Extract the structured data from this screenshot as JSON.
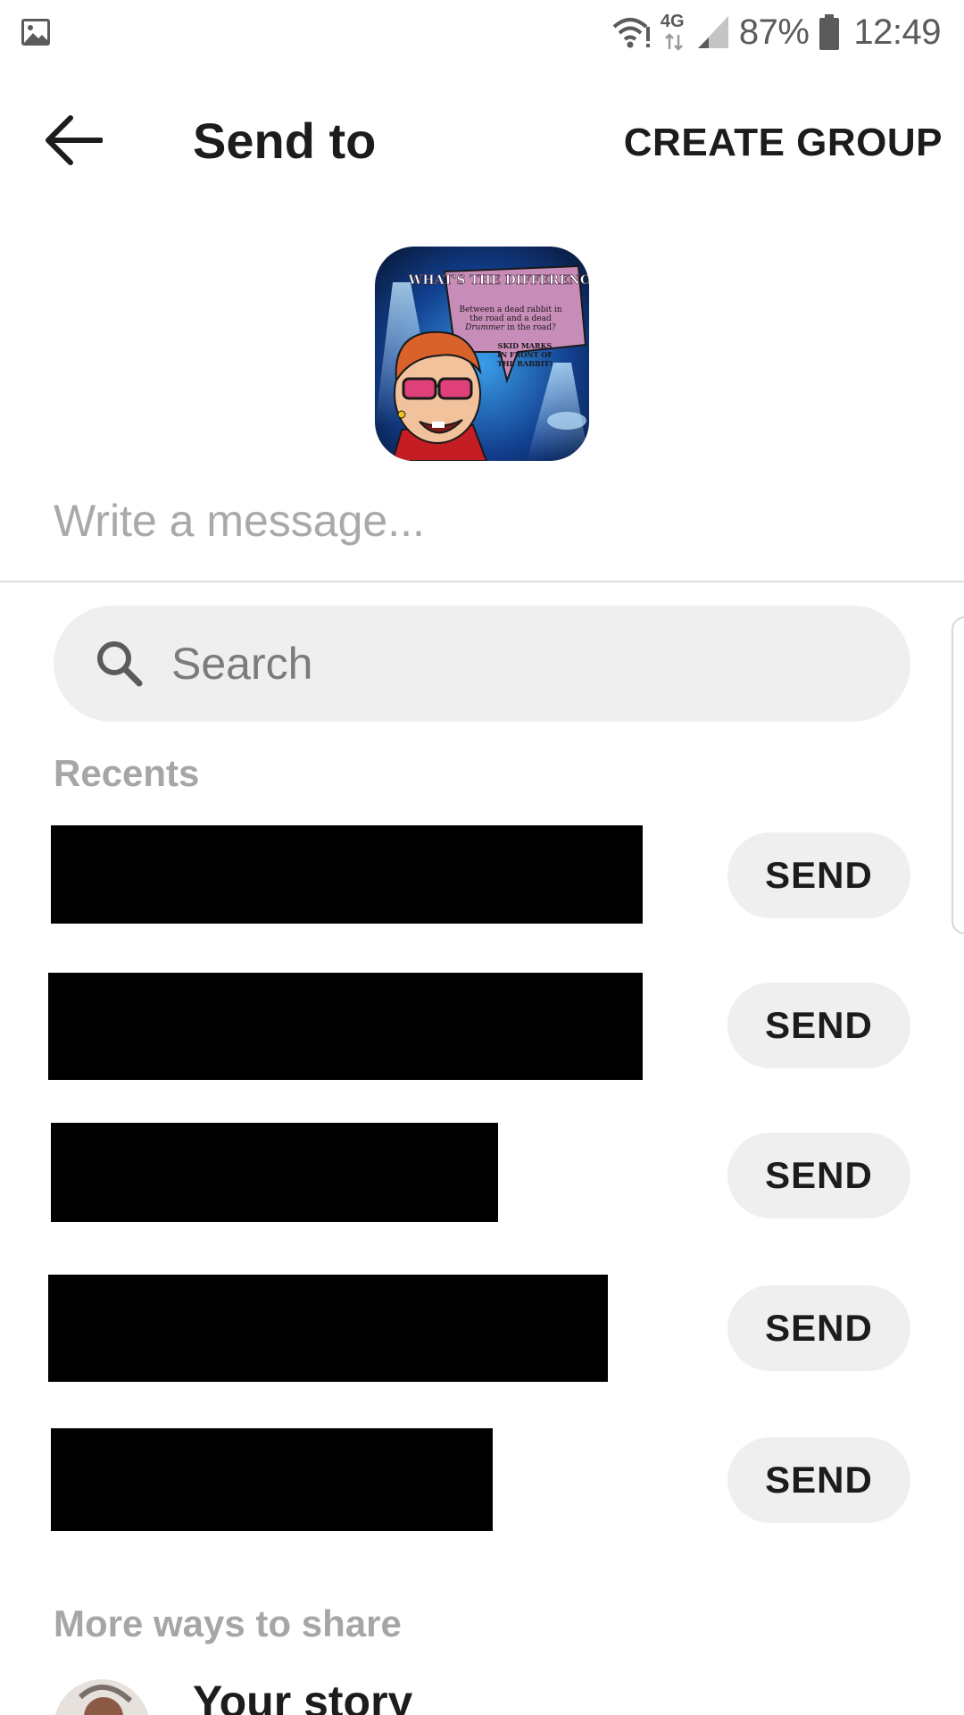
{
  "status_bar": {
    "network": "4G",
    "battery": "87%",
    "time": "12:49",
    "icons": [
      "gallery-icon",
      "wifi-alert-icon",
      "data-arrows-icon",
      "cell-signal-icon",
      "battery-icon"
    ]
  },
  "header": {
    "title": "Send to",
    "action": "CREATE GROUP",
    "back_icon": "arrow-left-icon"
  },
  "preview": {
    "headline": "WHAT'S THE DIFFERENCE...",
    "question_line1": "Between a dead rabbit in",
    "question_line2": "the road and a dead",
    "question_line3_em": "Drummer",
    "question_line3_rest": " in the road?",
    "answer_line1": "SKID MARKS",
    "answer_line2": "IN FRONT OF",
    "answer_line3": "THE RABBIT!"
  },
  "message": {
    "placeholder": "Write a message..."
  },
  "search": {
    "placeholder": "Search",
    "icon": "search-icon"
  },
  "recents": {
    "label": "Recents",
    "items": [
      {
        "send_label": "SEND"
      },
      {
        "send_label": "SEND"
      },
      {
        "send_label": "SEND"
      },
      {
        "send_label": "SEND"
      },
      {
        "send_label": "SEND"
      }
    ]
  },
  "more": {
    "label": "More ways to share",
    "story_label": "Your story"
  },
  "colors": {
    "background": "#ffffff",
    "pill": "#efefef",
    "muted_text": "#a6a6a6",
    "redaction": "#000000"
  }
}
